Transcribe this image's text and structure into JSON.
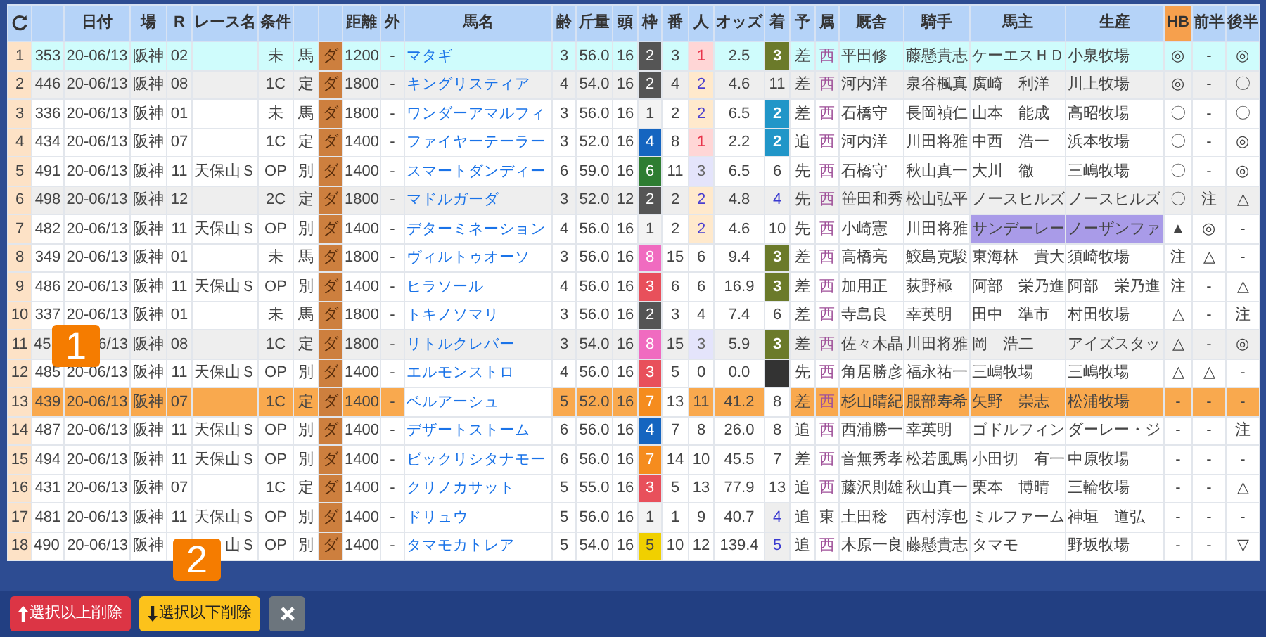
{
  "columns": [
    {
      "kind": "refresh",
      "highlighted": false
    },
    {
      "kind": "blank",
      "highlighted": false
    },
    {
      "kind": "text",
      "label": "日付",
      "highlighted": false
    },
    {
      "kind": "text",
      "label": "場",
      "highlighted": false
    },
    {
      "kind": "text",
      "label": "R",
      "highlighted": false
    },
    {
      "kind": "text",
      "label": "レース名",
      "highlighted": false
    },
    {
      "kind": "text",
      "label": "条件",
      "highlighted": false
    },
    {
      "kind": "blank",
      "highlighted": false
    },
    {
      "kind": "blank",
      "highlighted": false
    },
    {
      "kind": "text",
      "label": "距離",
      "highlighted": false
    },
    {
      "kind": "text",
      "label": "外",
      "highlighted": false
    },
    {
      "kind": "text",
      "label": "馬名",
      "highlighted": false
    },
    {
      "kind": "text",
      "label": "齢",
      "highlighted": false
    },
    {
      "kind": "text",
      "label": "斤量",
      "highlighted": false
    },
    {
      "kind": "text",
      "label": "頭",
      "highlighted": false
    },
    {
      "kind": "text",
      "label": "枠",
      "highlighted": false
    },
    {
      "kind": "text",
      "label": "番",
      "highlighted": false
    },
    {
      "kind": "text",
      "label": "人",
      "highlighted": false
    },
    {
      "kind": "text",
      "label": "オッズ",
      "highlighted": false
    },
    {
      "kind": "text",
      "label": "着",
      "highlighted": false
    },
    {
      "kind": "text",
      "label": "予",
      "highlighted": false
    },
    {
      "kind": "text",
      "label": "属",
      "highlighted": false
    },
    {
      "kind": "text",
      "label": "厩舎",
      "highlighted": false
    },
    {
      "kind": "text",
      "label": "騎手",
      "highlighted": false
    },
    {
      "kind": "text",
      "label": "馬主",
      "highlighted": false
    },
    {
      "kind": "text",
      "label": "生産",
      "highlighted": false
    },
    {
      "kind": "text",
      "label": "HB",
      "highlighted": true
    },
    {
      "kind": "text",
      "label": "前半",
      "highlighted": false
    },
    {
      "kind": "text",
      "label": "後半",
      "highlighted": false
    }
  ],
  "rows": [
    {
      "index": "1",
      "no": "353",
      "date": "20-06/13",
      "venue": "阪神",
      "race": "02",
      "cond": "未",
      "class": "馬",
      "surface": "ダ",
      "distance": "1200",
      "outer": "-",
      "horse": "マタギ",
      "age": "3",
      "weight": "56.0",
      "runners": "16",
      "waku": "2",
      "umaban": "3",
      "ninki": "1",
      "odds": "2.5",
      "finish": "3",
      "style": "差",
      "affiliation": "西",
      "color": "#a0529a",
      "trainer": "平田修",
      "jockey": "藤懸貴志",
      "owner": "ケーエスＨＤ",
      "breeder": "小泉牧場",
      "hb": "◎",
      "first_half": "-",
      "second_half": "◎",
      "selected": false,
      "highlighted": true,
      "shaded": false,
      "scratched": false,
      "owner_highlight": false
    },
    {
      "index": "2",
      "no": "446",
      "date": "20-06/13",
      "venue": "阪神",
      "race": "08",
      "cond": "1C",
      "class": "定",
      "surface": "ダ",
      "distance": "1800",
      "outer": "-",
      "horse": "キングリスティア",
      "age": "4",
      "weight": "54.0",
      "runners": "16",
      "waku": "2",
      "umaban": "4",
      "ninki": "2",
      "odds": "4.6",
      "finish": "11",
      "style": "差",
      "affiliation": "西",
      "color": "#a0529a",
      "trainer": "河内洋",
      "jockey": "泉谷楓真",
      "owner": "廣崎　利洋",
      "breeder": "川上牧場",
      "hb": "◎",
      "first_half": "-",
      "second_half": "〇",
      "selected": false,
      "highlighted": false,
      "shaded": true,
      "scratched": false,
      "owner_highlight": false
    },
    {
      "index": "3",
      "no": "336",
      "date": "20-06/13",
      "venue": "阪神",
      "race": "01",
      "cond": "未",
      "class": "馬",
      "surface": "ダ",
      "distance": "1800",
      "outer": "-",
      "horse": "ワンダーアマルフィ",
      "age": "3",
      "weight": "56.0",
      "runners": "16",
      "waku": "1",
      "umaban": "2",
      "ninki": "2",
      "odds": "6.5",
      "finish": "2",
      "style": "差",
      "affiliation": "西",
      "color": "#a0529a",
      "trainer": "石橋守",
      "jockey": "長岡禎仁",
      "owner": "山本　能成",
      "breeder": "高昭牧場",
      "hb": "〇",
      "first_half": "-",
      "second_half": "〇",
      "selected": false,
      "highlighted": false,
      "shaded": false,
      "scratched": false,
      "owner_highlight": false
    },
    {
      "index": "4",
      "no": "434",
      "date": "20-06/13",
      "venue": "阪神",
      "race": "07",
      "cond": "1C",
      "class": "定",
      "surface": "ダ",
      "distance": "1400",
      "outer": "-",
      "horse": "ファイヤーテーラー",
      "age": "3",
      "weight": "52.0",
      "runners": "16",
      "waku": "4",
      "umaban": "8",
      "ninki": "1",
      "odds": "2.2",
      "finish": "2",
      "style": "追",
      "affiliation": "西",
      "color": "#a0529a",
      "trainer": "河内洋",
      "jockey": "川田将雅",
      "owner": "中西　浩一",
      "breeder": "浜本牧場",
      "hb": "〇",
      "first_half": "-",
      "second_half": "◎",
      "selected": false,
      "highlighted": false,
      "shaded": false,
      "scratched": false,
      "owner_highlight": false
    },
    {
      "index": "5",
      "no": "491",
      "date": "20-06/13",
      "venue": "阪神",
      "race": "11",
      "race_name": "天保山Ｓ",
      "cond": "OP",
      "class": "別",
      "surface": "ダ",
      "distance": "1400",
      "outer": "-",
      "horse": "スマートダンディー",
      "age": "6",
      "weight": "59.0",
      "runners": "16",
      "waku": "6",
      "umaban": "11",
      "ninki": "3",
      "odds": "6.5",
      "finish": "6",
      "style": "先",
      "affiliation": "西",
      "color": "#a0529a",
      "trainer": "石橋守",
      "jockey": "秋山真一",
      "owner": "大川　徹",
      "breeder": "三嶋牧場",
      "hb": "〇",
      "first_half": "-",
      "second_half": "◎",
      "selected": false,
      "highlighted": false,
      "shaded": false,
      "scratched": false,
      "owner_highlight": false
    },
    {
      "index": "6",
      "no": "498",
      "date": "20-06/13",
      "venue": "阪神",
      "race": "12",
      "cond": "2C",
      "class": "定",
      "surface": "ダ",
      "distance": "1800",
      "outer": "-",
      "horse": "マドルガーダ",
      "age": "3",
      "weight": "52.0",
      "runners": "12",
      "waku": "2",
      "umaban": "2",
      "ninki": "2",
      "odds": "4.8",
      "finish": "4",
      "style": "先",
      "affiliation": "西",
      "color": "#a0529a",
      "trainer": "笹田和秀",
      "jockey": "松山弘平",
      "owner": "ノースヒルズ",
      "breeder": "ノースヒルズ",
      "hb": "〇",
      "first_half": "注",
      "second_half": "△",
      "selected": false,
      "highlighted": false,
      "shaded": true,
      "scratched": false,
      "owner_highlight": false
    },
    {
      "index": "7",
      "no": "482",
      "date": "20-06/13",
      "venue": "阪神",
      "race": "11",
      "race_name": "天保山Ｓ",
      "cond": "OP",
      "class": "別",
      "surface": "ダ",
      "distance": "1400",
      "outer": "-",
      "horse": "デターミネーション",
      "age": "4",
      "weight": "56.0",
      "runners": "16",
      "waku": "1",
      "umaban": "2",
      "ninki": "2",
      "odds": "4.6",
      "finish": "10",
      "style": "先",
      "affiliation": "西",
      "color": "#a0529a",
      "trainer": "小崎憲",
      "jockey": "川田将雅",
      "owner": "サンデーレー",
      "breeder": "ノーザンファ",
      "hb": "▲",
      "first_half": "◎",
      "second_half": "-",
      "selected": false,
      "highlighted": false,
      "shaded": false,
      "scratched": false,
      "owner_highlight": true
    },
    {
      "index": "8",
      "no": "349",
      "date": "20-06/13",
      "venue": "阪神",
      "race": "01",
      "cond": "未",
      "class": "馬",
      "surface": "ダ",
      "distance": "1800",
      "outer": "-",
      "horse": "ヴィルトゥオーソ",
      "age": "3",
      "weight": "56.0",
      "runners": "16",
      "waku": "8",
      "umaban": "15",
      "ninki": "6",
      "odds": "9.4",
      "finish": "3",
      "style": "差",
      "affiliation": "西",
      "color": "#a0529a",
      "trainer": "高橋亮",
      "jockey": "鮫島克駿",
      "owner": "東海林　貴大",
      "breeder": "須崎牧場",
      "hb": "注",
      "first_half": "△",
      "second_half": "-",
      "selected": false,
      "highlighted": false,
      "shaded": false,
      "scratched": false,
      "owner_highlight": false
    },
    {
      "index": "9",
      "no": "486",
      "date": "20-06/13",
      "venue": "阪神",
      "race": "11",
      "race_name": "天保山Ｓ",
      "cond": "OP",
      "class": "別",
      "surface": "ダ",
      "distance": "1400",
      "outer": "-",
      "horse": "ヒラソール",
      "age": "4",
      "weight": "56.0",
      "runners": "16",
      "waku": "3",
      "umaban": "6",
      "ninki": "6",
      "odds": "16.9",
      "finish": "3",
      "style": "差",
      "affiliation": "西",
      "color": "#a0529a",
      "trainer": "加用正",
      "jockey": "荻野極",
      "owner": "阿部　栄乃進",
      "breeder": "阿部　栄乃進",
      "hb": "注",
      "first_half": "-",
      "second_half": "△",
      "selected": false,
      "highlighted": false,
      "shaded": false,
      "scratched": false,
      "owner_highlight": false
    },
    {
      "index": "10",
      "no": "337",
      "date": "20-06/13",
      "venue": "阪神",
      "race": "01",
      "cond": "未",
      "class": "馬",
      "surface": "ダ",
      "distance": "1800",
      "outer": "-",
      "horse": "トキノソマリ",
      "age": "3",
      "weight": "56.0",
      "runners": "16",
      "waku": "2",
      "umaban": "3",
      "ninki": "4",
      "odds": "7.4",
      "finish": "6",
      "style": "差",
      "affiliation": "西",
      "color": "#a0529a",
      "trainer": "寺島良",
      "jockey": "幸英明",
      "owner": "田中　準市",
      "breeder": "村田牧場",
      "hb": "△",
      "first_half": "-",
      "second_half": "注",
      "selected": false,
      "highlighted": false,
      "shaded": false,
      "scratched": false,
      "owner_highlight": false
    },
    {
      "index": "11",
      "no": "45",
      "date": "6/13",
      "venue": "阪神",
      "race": "08",
      "cond": "1C",
      "class": "定",
      "surface": "ダ",
      "distance": "1800",
      "outer": "-",
      "horse": "リトルクレバー",
      "age": "3",
      "weight": "54.0",
      "runners": "16",
      "waku": "8",
      "umaban": "15",
      "ninki": "3",
      "odds": "5.9",
      "finish": "3",
      "style": "差",
      "affiliation": "西",
      "color": "#a0529a",
      "trainer": "佐々木晶",
      "jockey": "川田将雅",
      "owner": "岡　浩二",
      "breeder": "アイズスタッ",
      "hb": "△",
      "first_half": "-",
      "second_half": "◎",
      "selected": false,
      "highlighted": false,
      "shaded": true,
      "scratched": false,
      "owner_highlight": false,
      "badge": "1"
    },
    {
      "index": "12",
      "no": "485",
      "date": "20-06/13",
      "venue": "阪神",
      "race": "11",
      "race_name": "天保山Ｓ",
      "cond": "OP",
      "class": "別",
      "surface": "ダ",
      "distance": "1400",
      "outer": "-",
      "horse": "エルモンストロ",
      "age": "4",
      "weight": "56.0",
      "runners": "16",
      "waku": "3",
      "umaban": "5",
      "ninki": "0",
      "odds": "0.0",
      "style": "先",
      "affiliation": "西",
      "color": "#a0529a",
      "trainer": "角居勝彦",
      "jockey": "福永祐一",
      "owner": "三嶋牧場",
      "breeder": "三嶋牧場",
      "hb": "△",
      "first_half": "△",
      "second_half": "-",
      "selected": false,
      "highlighted": false,
      "shaded": false,
      "scratched": true,
      "owner_highlight": false
    },
    {
      "index": "13",
      "no": "439",
      "date": "20-06/13",
      "venue": "阪神",
      "race": "07",
      "cond": "1C",
      "class": "定",
      "surface": "ダ",
      "distance": "1400",
      "outer": "-",
      "horse": "ベルアーシュ",
      "age": "5",
      "weight": "52.0",
      "runners": "16",
      "waku": "7",
      "umaban": "13",
      "ninki": "11",
      "odds": "41.2",
      "finish": "8",
      "style": "差",
      "affiliation": "西",
      "color": "#a0529a",
      "trainer": "杉山晴紀",
      "jockey": "服部寿希",
      "owner": "矢野　崇志",
      "breeder": "松浦牧場",
      "hb": "-",
      "first_half": "-",
      "second_half": "-",
      "selected": true,
      "highlighted": false,
      "shaded": false,
      "scratched": false,
      "owner_highlight": false
    },
    {
      "index": "14",
      "no": "487",
      "date": "20-06/13",
      "venue": "阪神",
      "race": "11",
      "race_name": "天保山Ｓ",
      "cond": "OP",
      "class": "別",
      "surface": "ダ",
      "distance": "1400",
      "outer": "-",
      "horse": "デザートストーム",
      "age": "6",
      "weight": "56.0",
      "runners": "16",
      "waku": "4",
      "umaban": "7",
      "ninki": "8",
      "odds": "26.0",
      "finish": "8",
      "style": "追",
      "affiliation": "西",
      "color": "#a0529a",
      "trainer": "西浦勝一",
      "jockey": "幸英明",
      "owner": "ゴドルフィン",
      "breeder": "ダーレー・ジ",
      "hb": "-",
      "first_half": "-",
      "second_half": "注",
      "selected": false,
      "highlighted": false,
      "shaded": false,
      "scratched": false,
      "owner_highlight": false
    },
    {
      "index": "15",
      "no": "494",
      "date": "20-06/13",
      "venue": "阪神",
      "race": "11",
      "race_name": "天保山Ｓ",
      "cond": "OP",
      "class": "別",
      "surface": "ダ",
      "distance": "1400",
      "outer": "-",
      "horse": "ビックリシタナモー",
      "age": "6",
      "weight": "56.0",
      "runners": "16",
      "waku": "7",
      "umaban": "14",
      "ninki": "10",
      "odds": "45.5",
      "finish": "7",
      "style": "差",
      "affiliation": "西",
      "color": "#a0529a",
      "trainer": "音無秀孝",
      "jockey": "松若風馬",
      "owner": "小田切　有一",
      "breeder": "中原牧場",
      "hb": "-",
      "first_half": "-",
      "second_half": "-",
      "selected": false,
      "highlighted": false,
      "shaded": false,
      "scratched": false,
      "owner_highlight": false
    },
    {
      "index": "16",
      "no": "431",
      "date": "20-06/13",
      "venue": "阪神",
      "race": "07",
      "cond": "1C",
      "class": "定",
      "surface": "ダ",
      "distance": "1400",
      "outer": "-",
      "horse": "クリノカサット",
      "age": "5",
      "weight": "55.0",
      "runners": "16",
      "waku": "3",
      "umaban": "5",
      "ninki": "13",
      "odds": "77.9",
      "finish": "13",
      "style": "追",
      "affiliation": "西",
      "color": "#a0529a",
      "trainer": "藤沢則雄",
      "jockey": "秋山真一",
      "owner": "栗本　博晴",
      "breeder": "三輪牧場",
      "hb": "-",
      "first_half": "-",
      "second_half": "△",
      "selected": false,
      "highlighted": false,
      "shaded": false,
      "scratched": false,
      "owner_highlight": false
    },
    {
      "index": "17",
      "no": "481",
      "date": "20-06/13",
      "venue": "阪神",
      "race": "11",
      "race_name": "天保山Ｓ",
      "cond": "OP",
      "class": "別",
      "surface": "ダ",
      "distance": "1400",
      "outer": "-",
      "horse": "ドリュウ",
      "age": "5",
      "weight": "56.0",
      "runners": "16",
      "waku": "1",
      "umaban": "1",
      "ninki": "9",
      "odds": "40.7",
      "finish": "4",
      "style": "追",
      "affiliation": "東",
      "color": "#444444",
      "trainer": "土田稔",
      "jockey": "西村淳也",
      "owner": "ミルファーム",
      "breeder": "神垣　道弘",
      "hb": "-",
      "first_half": "-",
      "second_half": "-",
      "selected": false,
      "highlighted": false,
      "shaded": false,
      "scratched": false,
      "owner_highlight": false
    },
    {
      "index": "18",
      "no": "490",
      "date": "20-06/13",
      "venue": "阪神",
      "race_name": "山Ｓ",
      "cond": "OP",
      "class": "別",
      "surface": "ダ",
      "distance": "1400",
      "outer": "-",
      "horse": "タマモカトレア",
      "age": "5",
      "weight": "54.0",
      "runners": "16",
      "waku": "5",
      "umaban": "10",
      "ninki": "12",
      "odds": "139.4",
      "finish": "5",
      "style": "追",
      "affiliation": "西",
      "color": "#a0529a",
      "trainer": "木原一良",
      "jockey": "藤懸貴志",
      "owner": "タマモ",
      "breeder": "野坂牧場",
      "hb": "-",
      "first_half": "-",
      "second_half": "▽",
      "selected": false,
      "highlighted": false,
      "shaded": false,
      "scratched": false,
      "owner_highlight": false,
      "badge": "2"
    }
  ],
  "buttons": [
    {
      "kind": "delete_above",
      "label": "選択以上削除"
    },
    {
      "kind": "delete_below",
      "label": "選択以下削除"
    },
    {
      "kind": "close"
    }
  ]
}
